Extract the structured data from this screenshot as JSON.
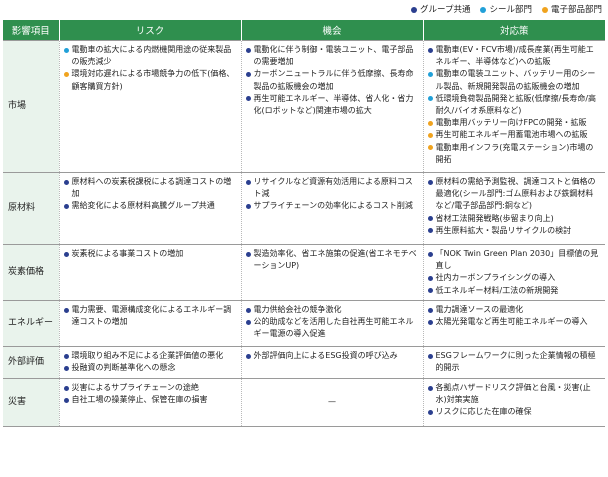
{
  "legend": [
    {
      "label": "グループ共通",
      "color": "#2b3f8f"
    },
    {
      "label": "シール部門",
      "color": "#21a0d8"
    },
    {
      "label": "電子部品部門",
      "color": "#f0a31e"
    }
  ],
  "colors": {
    "group": "#2b3f8f",
    "seal": "#21a0d8",
    "electronic": "#f0a31e",
    "header": "#2f8f4e"
  },
  "headers": [
    "影響項目",
    "リスク",
    "機会",
    "対応策"
  ],
  "rows": [
    {
      "category": "市場",
      "risk": [
        {
          "text": "電動車の拡大による内燃機関用途の従来製品の販売減少",
          "type": "seal"
        },
        {
          "text": "環境対応遅れによる市場競争力の低下(価格、顧客購買方針)",
          "type": "electronic"
        }
      ],
      "opportunity": [
        {
          "text": "電動化に伴う制御・電装ユニット、電子部品の需要増加",
          "type": "group"
        },
        {
          "text": "カーボンニュートラルに伴う低摩擦、長寿命製品の拡販機会の増加",
          "type": "group"
        },
        {
          "text": "再生可能エネルギー、半導体、省人化・省力化(ロボットなど)関連市場の拡大",
          "type": "group"
        }
      ],
      "response": [
        {
          "text": "電動車(EV・FCV市場)/成長産業(再生可能エネルギー、半導体など)への拡販",
          "type": "group"
        },
        {
          "text": "電動車の電装ユニット、バッテリー用のシール製品、新規開発製品の拡販機会の増加",
          "type": "seal"
        },
        {
          "text": "低環境負荷製品開発と拡販(低摩擦/長寿命/高耐久/バイオ系原料など)",
          "type": "seal"
        },
        {
          "text": "電動車用バッテリー向けFPCの開発・拡販",
          "type": "electronic"
        },
        {
          "text": "再生可能エネルギー用蓄電池市場への拡販",
          "type": "electronic"
        },
        {
          "text": "電動車用インフラ(充電ステーション)市場の開拓",
          "type": "electronic"
        }
      ]
    },
    {
      "category": "原材料",
      "risk": [
        {
          "text": "原材料への炭素税課税による調達コストの増加",
          "type": "group"
        },
        {
          "text": "需給変化による原材料高騰グループ共通",
          "type": "group"
        }
      ],
      "opportunity": [
        {
          "text": "リサイクルなど資源有効活用による原料コスト減",
          "type": "group"
        },
        {
          "text": "サプライチェーンの効率化によるコスト削減",
          "type": "group"
        }
      ],
      "response": [
        {
          "text": "原材料の需給予測監視、調達コストと価格の最適化(シール部門:ゴム原料および鉄鋼材料など/電子部品部門:銅など)",
          "type": "group"
        },
        {
          "text": "省材工法開発戦略(歩留まり向上)",
          "type": "group"
        },
        {
          "text": "再生原料拡大・製品リサイクルの検討",
          "type": "group"
        }
      ]
    },
    {
      "category": "炭素価格",
      "risk": [
        {
          "text": "炭素税による事業コストの増加",
          "type": "group"
        }
      ],
      "opportunity": [
        {
          "text": "製造効率化、省エネ施策の促進(省エネモチベーションUP)",
          "type": "group"
        }
      ],
      "response": [
        {
          "text": "「NOK Twin Green Plan 2030」目標値の見直し",
          "type": "group"
        },
        {
          "text": "社内カーボンプライシングの導入",
          "type": "group"
        },
        {
          "text": "低エネルギー材料/工法の新規開発",
          "type": "group"
        }
      ]
    },
    {
      "category": "エネルギー",
      "risk": [
        {
          "text": "電力需要、電源構成変化によるエネルギー調達コストの増加",
          "type": "group"
        }
      ],
      "opportunity": [
        {
          "text": "電力供給会社の競争激化",
          "type": "group"
        },
        {
          "text": "公的助成などを活用した自社再生可能エネルギー電源の導入促進",
          "type": "group"
        }
      ],
      "response": [
        {
          "text": "電力調達ソースの最適化",
          "type": "group"
        },
        {
          "text": "太陽光発電など再生可能エネルギーの導入",
          "type": "group"
        }
      ]
    },
    {
      "category": "外部評価",
      "risk": [
        {
          "text": "環境取り組み不足による企業評価値の悪化",
          "type": "group"
        },
        {
          "text": "投融資の判断基準化への懸念",
          "type": "group"
        }
      ],
      "opportunity": [
        {
          "text": "外部評価向上によるESG投資の呼び込み",
          "type": "group"
        }
      ],
      "response": [
        {
          "text": "ESGフレームワークに則った企業情報の積極的開示",
          "type": "group"
        }
      ]
    },
    {
      "category": "災害",
      "risk": [
        {
          "text": "災害によるサプライチェーンの途絶",
          "type": "group"
        },
        {
          "text": "自社工場の操業停止、保管在庫の損害",
          "type": "group"
        }
      ],
      "opportunity_text": "—",
      "response": [
        {
          "text": "各拠点ハザードリスク評価と台風・災害(止水)対策実施",
          "type": "group"
        },
        {
          "text": "リスクに応じた在庫の確保",
          "type": "group"
        }
      ]
    }
  ]
}
